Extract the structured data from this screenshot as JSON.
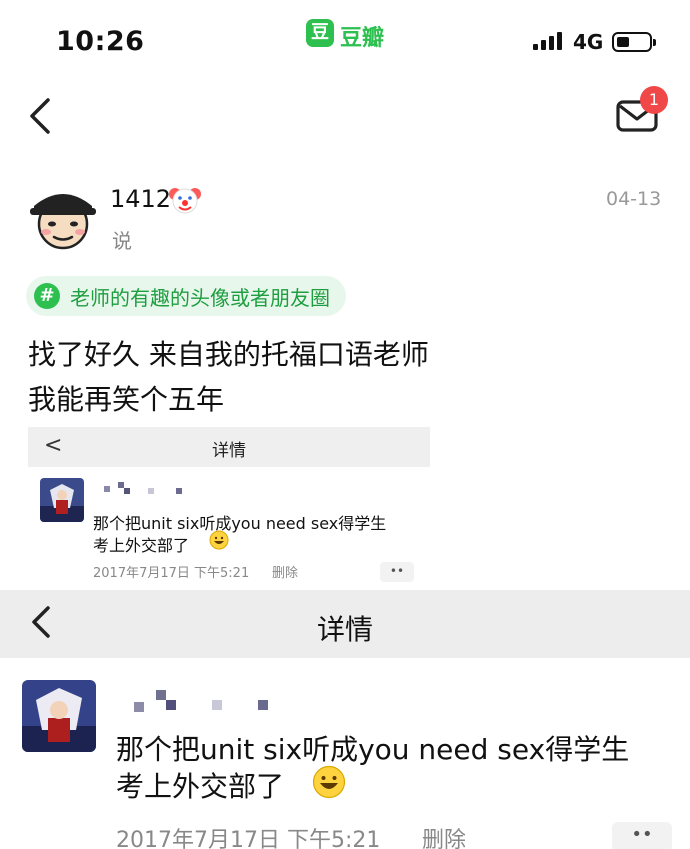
{
  "status_bar": {
    "time": "10:26",
    "app_badge": "豆",
    "app_name": "豆瓣",
    "network": "4G"
  },
  "nav": {
    "notification_count": "1"
  },
  "post": {
    "username": "1412",
    "verb": "说",
    "date": "04-13",
    "topic_icon": "#",
    "topic": "老师的有趣的头像或者朋友圈",
    "lines": [
      "找了好久 来自我的托福口语老师",
      "我能再笑个五年"
    ]
  },
  "screenshot_small": {
    "header_title": "详情",
    "back_glyph": "<",
    "text_line1": "那个把unit six听成you need sex得学生",
    "text_line2": "考上外交部了",
    "meta": "2017年7月17日  下午5:21",
    "delete_label": "删除",
    "more_label": "••"
  },
  "screenshot_big": {
    "header_title": "详情",
    "back_glyph": "<",
    "text_line1": "那个把unit six听成you need sex得学生",
    "text_line2": "考上外交部了",
    "meta": "2017年7月17日  下午5:21",
    "delete_label": "删除",
    "more_label": "••"
  },
  "colors": {
    "douban_green": "#2dc04f",
    "badge_red": "#f04848",
    "topic_bg": "#e8f7ec"
  },
  "icons": [
    "back-chevron-icon",
    "mail-icon",
    "signal-icon",
    "battery-icon",
    "hashtag-icon",
    "clown-emoji-icon",
    "smile-emoji-icon"
  ]
}
